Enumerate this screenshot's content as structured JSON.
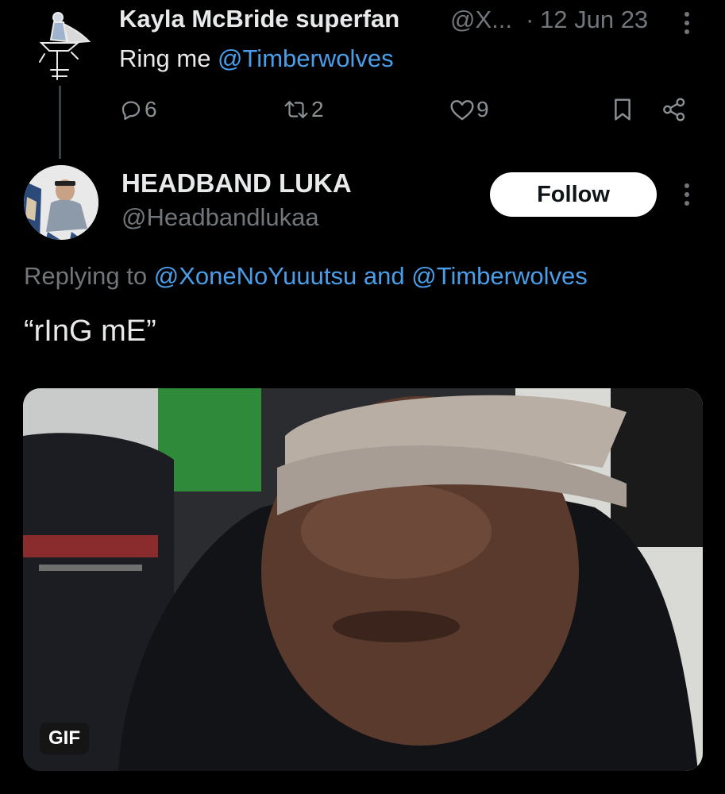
{
  "tweet1": {
    "name": "Kayla McBride superfan",
    "handle": "@X...",
    "dot": "·",
    "date": "12 Jun 23",
    "text_prefix": "Ring me ",
    "mention": "@Timberwolves",
    "replies": "6",
    "retweets": "2",
    "likes": "9",
    "avatar_icon": "knight-sketch-avatar",
    "more_icon": "more-vertical-icon"
  },
  "tweet2": {
    "name": "HEADBAND LUKA",
    "handle": "@Headbandlukaa",
    "follow_label": "Follow",
    "replying_prefix": "Replying to ",
    "replying_mention1": "@XoneNoYuuutsu",
    "replying_and": " and ",
    "replying_mention2": "@Timberwolves",
    "text": "“rInG mE”",
    "media_badge": "GIF",
    "more_icon": "more-vertical-icon"
  },
  "colors": {
    "background": "#000000",
    "text": "#e7e9ea",
    "secondary": "#71767b",
    "link": "#4a9ee9",
    "follow_bg": "#ffffff"
  }
}
